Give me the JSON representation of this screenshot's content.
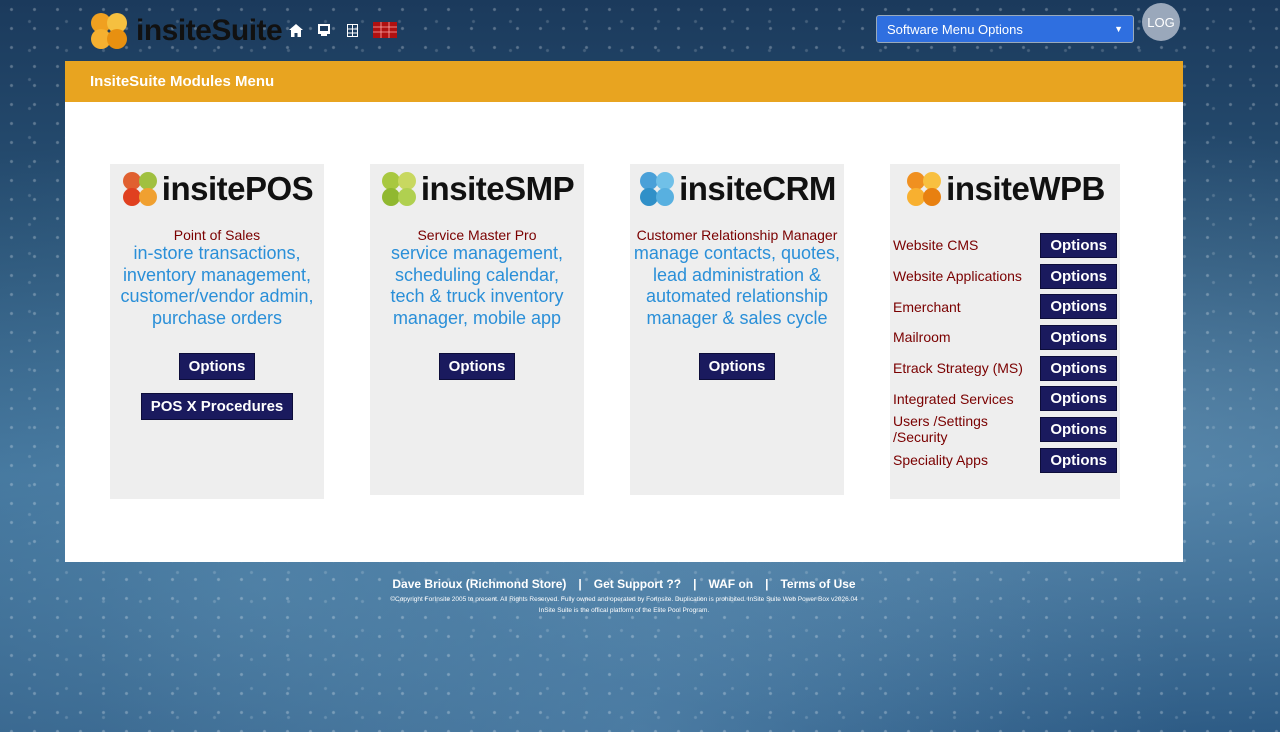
{
  "brand": {
    "name": "insiteSuite"
  },
  "toolbar": {
    "icons": [
      "home-icon",
      "monitor-icon",
      "calculator-icon",
      "calendar-icon"
    ]
  },
  "header": {
    "menu_select": "Software Menu Options",
    "log_button": "LOG"
  },
  "panel": {
    "title": "InsiteSuite Modules Menu"
  },
  "modules": {
    "pos": {
      "name": "insitePOS",
      "subtitle": "Point of Sales",
      "description": "in-store transactions, inventory management, customer/vendor admin, purchase orders",
      "options_label": "Options",
      "procedures_label": "POS X Procedures"
    },
    "smp": {
      "name": "insiteSMP",
      "subtitle": "Service Master Pro",
      "description": "service management, scheduling calendar, tech & truck inventory manager, mobile app",
      "options_label": "Options"
    },
    "crm": {
      "name": "insiteCRM",
      "subtitle": "Customer Relationship Manager",
      "description": "manage contacts, quotes, lead administration & automated relationship manager & sales cycle",
      "options_label": "Options"
    },
    "wpb": {
      "name": "insiteWPB",
      "items": [
        {
          "label": "Website CMS",
          "button": "Options"
        },
        {
          "label": "Website Applications",
          "button": "Options"
        },
        {
          "label": "Emerchant",
          "button": "Options"
        },
        {
          "label": "Mailroom",
          "button": "Options"
        },
        {
          "label": "Etrack Strategy (MS)",
          "button": "Options"
        },
        {
          "label": "Integrated Services",
          "button": "Options"
        },
        {
          "label": "Users /Settings /Security",
          "button": "Options"
        },
        {
          "label": "Speciality Apps",
          "button": "Options"
        }
      ]
    }
  },
  "footer": {
    "user": "Dave Brioux (Richmond Store)",
    "support": "Get Support ??",
    "waf": "WAF on",
    "terms": "Terms of Use",
    "separator": "|",
    "copyright": "©Copyright ForInsite 2005 to present. All Rights Reserved. Fully owned and operated by ForInsite. Duplication is prohibited. InSite Suite Web Power Box v2026.04",
    "platform": "InSite Suite is the offical platform of the Elite Pool Program."
  },
  "colors": {
    "header_orange": "#e8a420",
    "button_navy": "#1a1a5e",
    "description_blue": "#2a8fd8",
    "label_maroon": "#7a0000",
    "select_blue": "#2f6fe0"
  }
}
